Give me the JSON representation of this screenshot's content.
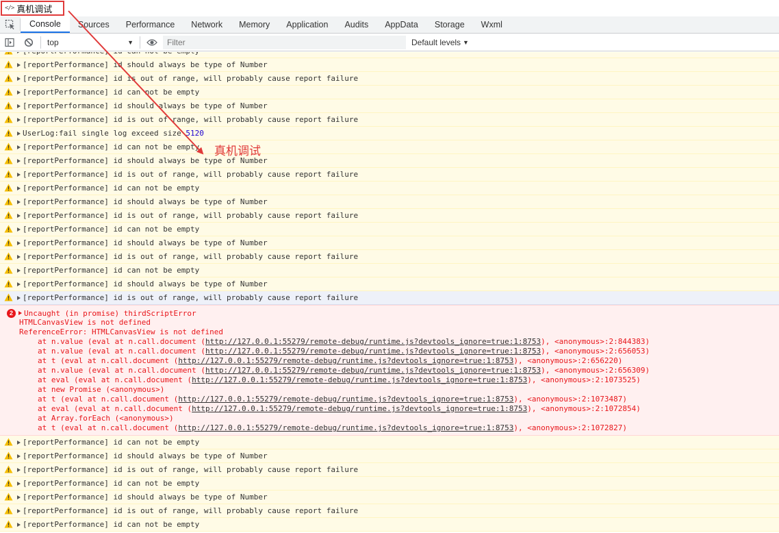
{
  "window": {
    "title": "真机调试",
    "annotation_label": "真机调试"
  },
  "tabs": [
    "Console",
    "Sources",
    "Performance",
    "Network",
    "Memory",
    "Application",
    "Audits",
    "AppData",
    "Storage",
    "Wxml"
  ],
  "toolbar": {
    "context": "top",
    "filter_placeholder": "Filter",
    "levels": "Default levels"
  },
  "colors": {
    "warning_bg": "#fffbe6",
    "error_bg": "#fff0f0",
    "error_text": "#e8161b",
    "accent": "#1a73e8",
    "annotation": "#e03a3a"
  },
  "console": {
    "warnings_top": [
      {
        "text": "[reportPerformance] id can not be empty"
      },
      {
        "text": "[reportPerformance] id should always be type of Number"
      },
      {
        "text": "[reportPerformance] id is out of range, will probably cause report failure"
      },
      {
        "text": "[reportPerformance] id can not be empty"
      },
      {
        "text": "[reportPerformance] id should always be type of Number"
      },
      {
        "text": "[reportPerformance] id is out of range, will probably cause report failure"
      },
      {
        "text": "UserLog:fail single log exceed size ",
        "num": "5120"
      },
      {
        "text": "[reportPerformance] id can not be empty"
      },
      {
        "text": "[reportPerformance] id should always be type of Number"
      },
      {
        "text": "[reportPerformance] id is out of range, will probably cause report failure"
      },
      {
        "text": "[reportPerformance] id can not be empty"
      },
      {
        "text": "[reportPerformance] id should always be type of Number"
      },
      {
        "text": "[reportPerformance] id is out of range, will probably cause report failure"
      },
      {
        "text": "[reportPerformance] id can not be empty"
      },
      {
        "text": "[reportPerformance] id should always be type of Number"
      },
      {
        "text": "[reportPerformance] id is out of range, will probably cause report failure"
      },
      {
        "text": "[reportPerformance] id can not be empty"
      },
      {
        "text": "[reportPerformance] id should always be type of Number"
      },
      {
        "text": "[reportPerformance] id is out of range, will probably cause report failure"
      }
    ],
    "error": {
      "count": "2",
      "head": "Uncaught (in promise) thirdScriptError",
      "message": "HTMLCanvasView is not defined",
      "reference": "ReferenceError: HTMLCanvasView is not defined",
      "stack": [
        {
          "pre": "at n.value (eval at n.call.document (",
          "url": "http://127.0.0.1:55279/remote-debug/runtime.js?devtools_ignore=true:1:8753",
          "post": "), <anonymous>:2:844383)"
        },
        {
          "pre": "at n.value (eval at n.call.document (",
          "url": "http://127.0.0.1:55279/remote-debug/runtime.js?devtools_ignore=true:1:8753",
          "post": "), <anonymous>:2:656053)"
        },
        {
          "pre": "at t (eval at n.call.document (",
          "url": "http://127.0.0.1:55279/remote-debug/runtime.js?devtools_ignore=true:1:8753",
          "post": "), <anonymous>:2:656220)"
        },
        {
          "pre": "at n.value (eval at n.call.document (",
          "url": "http://127.0.0.1:55279/remote-debug/runtime.js?devtools_ignore=true:1:8753",
          "post": "), <anonymous>:2:656309)"
        },
        {
          "pre": "at eval (eval at n.call.document (",
          "url": "http://127.0.0.1:55279/remote-debug/runtime.js?devtools_ignore=true:1:8753",
          "post": "), <anonymous>:2:1073525)"
        },
        {
          "pre": "at new Promise (<anonymous>)",
          "url": "",
          "post": ""
        },
        {
          "pre": "at t (eval at n.call.document (",
          "url": "http://127.0.0.1:55279/remote-debug/runtime.js?devtools_ignore=true:1:8753",
          "post": "), <anonymous>:2:1073487)"
        },
        {
          "pre": "at eval (eval at n.call.document (",
          "url": "http://127.0.0.1:55279/remote-debug/runtime.js?devtools_ignore=true:1:8753",
          "post": "), <anonymous>:2:1072854)"
        },
        {
          "pre": "at Array.forEach (<anonymous>)",
          "url": "",
          "post": ""
        },
        {
          "pre": "at t (eval at n.call.document (",
          "url": "http://127.0.0.1:55279/remote-debug/runtime.js?devtools_ignore=true:1:8753",
          "post": "), <anonymous>:2:1072827)"
        }
      ]
    },
    "warnings_bottom": [
      {
        "text": "[reportPerformance] id can not be empty"
      },
      {
        "text": "[reportPerformance] id should always be type of Number"
      },
      {
        "text": "[reportPerformance] id is out of range, will probably cause report failure"
      },
      {
        "text": "[reportPerformance] id can not be empty"
      },
      {
        "text": "[reportPerformance] id should always be type of Number"
      },
      {
        "text": "[reportPerformance] id is out of range, will probably cause report failure"
      },
      {
        "text": "[reportPerformance] id can not be empty"
      }
    ]
  }
}
